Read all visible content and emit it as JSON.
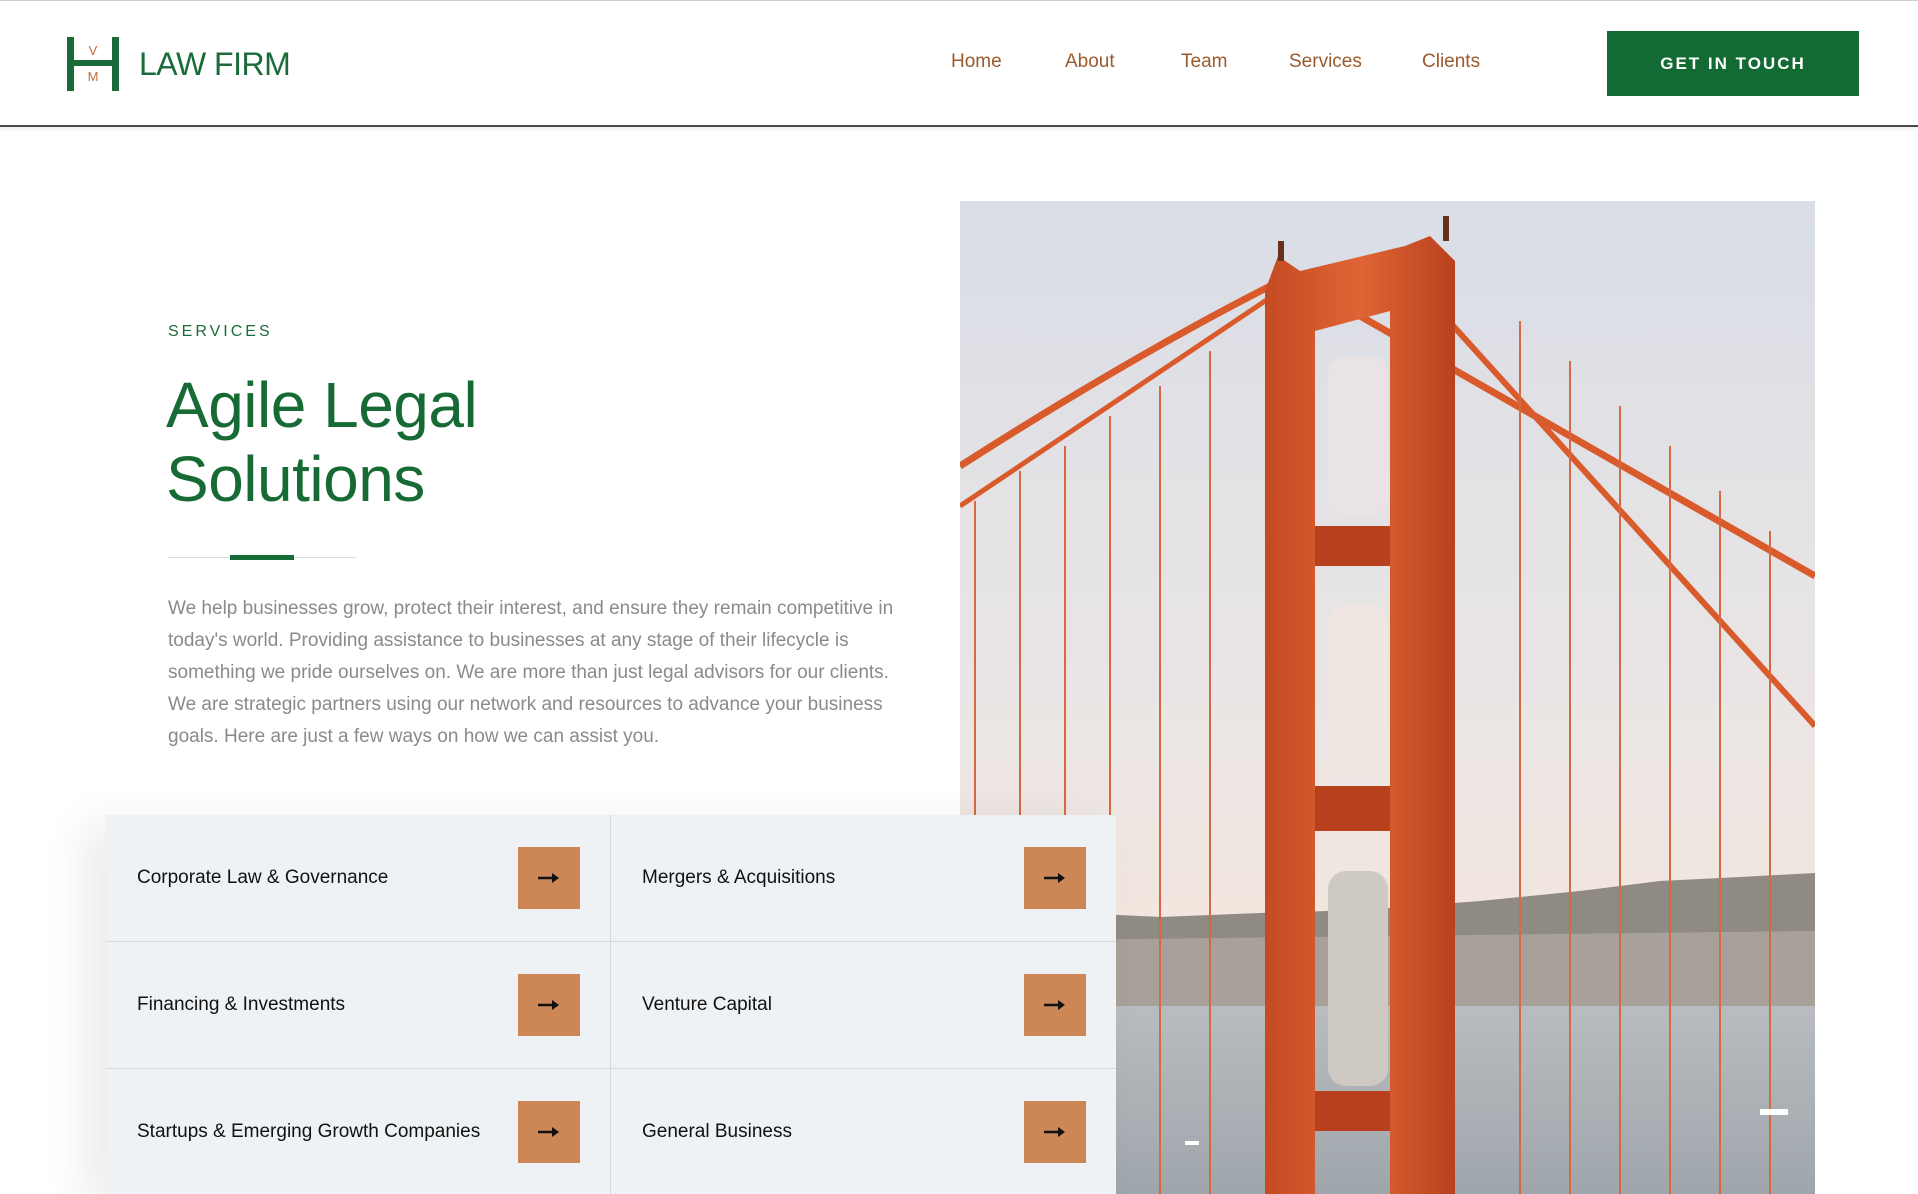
{
  "header": {
    "logo": {
      "monogram": "HVM",
      "text": "LAW FIRM"
    },
    "nav": [
      {
        "label": "Home"
      },
      {
        "label": "About"
      },
      {
        "label": "Team"
      },
      {
        "label": "Services"
      },
      {
        "label": "Clients"
      }
    ],
    "cta_label": "GET IN TOUCH"
  },
  "intro": {
    "eyebrow": "SERVICES",
    "title": "Agile Legal Solutions",
    "description": "We help businesses grow, protect their interest, and ensure they remain competitive in today's world. Providing assistance to businesses at any stage of their lifecycle is something we pride ourselves on. We are more than just legal advisors for our clients. We are strategic partners using our network and resources to advance your business goals. Here are just a few ways on how we can assist you."
  },
  "services": [
    {
      "label": "Corporate Law & Governance",
      "icon": "arrow-right-icon"
    },
    {
      "label": "Mergers & Acquisitions",
      "icon": "arrow-right-icon"
    },
    {
      "label": "Financing & Investments",
      "icon": "arrow-right-icon"
    },
    {
      "label": "Venture Capital",
      "icon": "arrow-right-icon"
    },
    {
      "label": "Startups & Emerging Growth Companies",
      "icon": "arrow-right-icon"
    },
    {
      "label": "General Business",
      "icon": "arrow-right-icon"
    }
  ],
  "colors": {
    "brand_green": "#136b34",
    "nav_brown": "#9a5a2c",
    "arrow_tile": "#cd8656",
    "service_bg": "#eff2f5"
  },
  "photo": {
    "subject": "bridge-tower-photo"
  }
}
